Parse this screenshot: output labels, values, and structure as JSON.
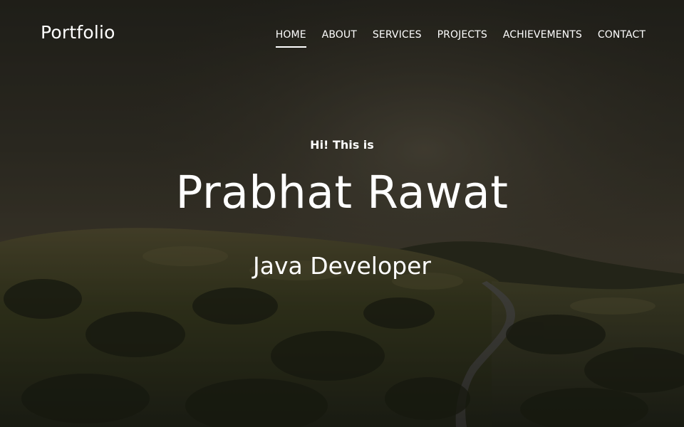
{
  "navbar": {
    "brand": "Portfolio",
    "links": [
      {
        "label": "HOME",
        "active": true
      },
      {
        "label": "ABOUT",
        "active": false
      },
      {
        "label": "SERVICES",
        "active": false
      },
      {
        "label": "PROJECTS",
        "active": false
      },
      {
        "label": "ACHIEVEMENTS",
        "active": false
      },
      {
        "label": "CONTACT",
        "active": false
      }
    ]
  },
  "hero": {
    "greeting": "Hi! This is",
    "name": "Prabhat Rawat",
    "role": "Java Developer"
  },
  "colors": {
    "text": "#ffffff",
    "background_dark": "#2a2a22"
  }
}
